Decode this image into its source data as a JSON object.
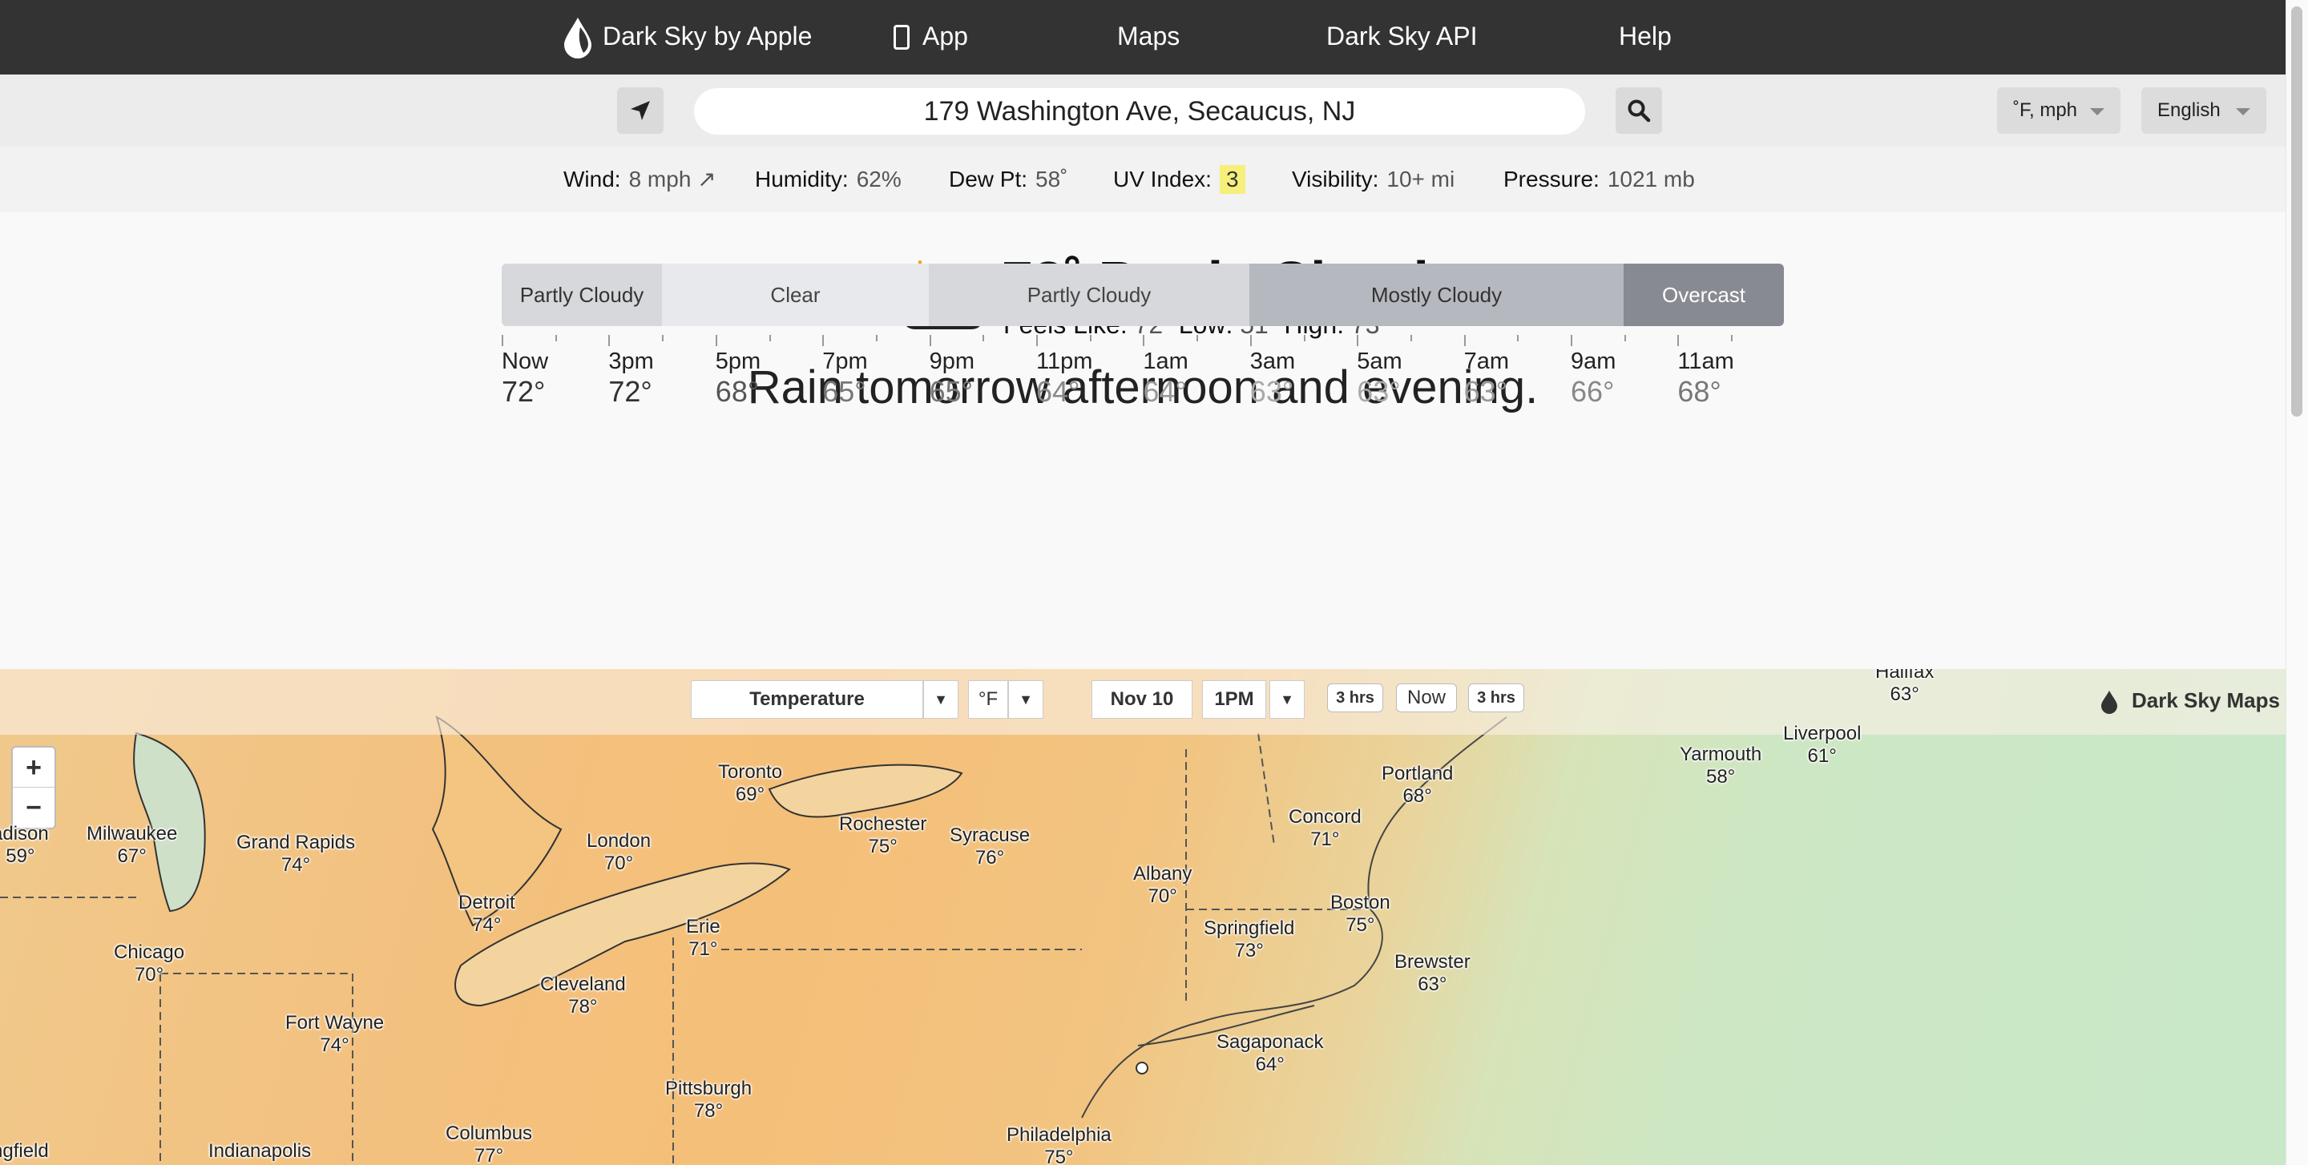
{
  "nav": {
    "brand": "Dark Sky by Apple",
    "app": "App",
    "maps": "Maps",
    "api": "Dark Sky API",
    "help": "Help",
    "brand_icon": "raindrop-logo-icon",
    "app_icon": "phone-icon"
  },
  "search": {
    "address": "179 Washington Ave, Secaucus, NJ",
    "location_icon": "location-arrow-icon",
    "search_icon": "search-icon",
    "units": "˚F, mph",
    "language": "English"
  },
  "stats": {
    "wind_label": "Wind:",
    "wind_value": "8 mph ↗",
    "humidity_label": "Humidity:",
    "humidity_value": "62%",
    "dew_label": "Dew Pt:",
    "dew_value": "58˚",
    "uv_label": "UV Index:",
    "uv_value": "3",
    "visibility_label": "Visibility:",
    "visibility_value": "10+ mi",
    "pressure_label": "Pressure:",
    "pressure_value": "1021 mb",
    "uv_color": "#f6ef7a"
  },
  "current": {
    "icon": "partly-cloudy-icon",
    "headline": "72˚ Partly Cloudy.",
    "feels_label": "Feels Like:",
    "feels_value": "72˚",
    "low_label": "Low:",
    "low_value": "51˚",
    "high_label": "High:",
    "high_value": "73˚",
    "summary": "Rain tomorrow afternoon and evening."
  },
  "timeline": {
    "segments": [
      {
        "label": "Partly Cloudy",
        "color": "#d6d8dc",
        "text_color": "#333333"
      },
      {
        "label": "Clear",
        "color": "#e8e9ec",
        "text_color": "#444444"
      },
      {
        "label": "Partly Cloudy",
        "color": "#d6d8dc",
        "text_color": "#444444"
      },
      {
        "label": "Mostly Cloudy",
        "color": "#b5b8bf",
        "text_color": "#333333"
      },
      {
        "label": "Overcast",
        "color": "#878a91",
        "text_color": "#ffffff"
      }
    ],
    "hours": [
      {
        "time": "Now",
        "temp": "72°",
        "color": "#333333"
      },
      {
        "time": "3pm",
        "temp": "72°",
        "color": "#333333"
      },
      {
        "time": "5pm",
        "temp": "68°",
        "color": "#555555"
      },
      {
        "time": "7pm",
        "temp": "65°",
        "color": "#777777"
      },
      {
        "time": "9pm",
        "temp": "65°",
        "color": "#777777"
      },
      {
        "time": "11pm",
        "temp": "64°",
        "color": "#888888"
      },
      {
        "time": "1am",
        "temp": "64°",
        "color": "#999999"
      },
      {
        "time": "3am",
        "temp": "63°",
        "color": "#aaaaaa"
      },
      {
        "time": "5am",
        "temp": "63°",
        "color": "#aaaaaa"
      },
      {
        "time": "7am",
        "temp": "63°",
        "color": "#999999"
      },
      {
        "time": "9am",
        "temp": "66°",
        "color": "#888888"
      },
      {
        "time": "11am",
        "temp": "68°",
        "color": "#777777"
      }
    ]
  },
  "map": {
    "layer": "Temperature",
    "unit": "°F",
    "date": "Nov 10",
    "time": "1PM",
    "back_step": "3 hrs",
    "now": "Now",
    "forward_step": "3 hrs",
    "brand": "Dark Sky Maps",
    "zoom_in": "+",
    "zoom_out": "−",
    "cities": [
      {
        "name": "Milwaukee",
        "temp": "67°"
      },
      {
        "name": "Grand Rapids",
        "temp": "74°"
      },
      {
        "name": "Toronto",
        "temp": "69°"
      },
      {
        "name": "London",
        "temp": "70°"
      },
      {
        "name": "Rochester",
        "temp": "75°"
      },
      {
        "name": "Syracuse",
        "temp": "76°"
      },
      {
        "name": "Albany",
        "temp": "70°"
      },
      {
        "name": "Concord",
        "temp": "71°"
      },
      {
        "name": "Portland",
        "temp": "68°"
      },
      {
        "name": "Yarmouth",
        "temp": "58°"
      },
      {
        "name": "Liverpool",
        "temp": "61°"
      },
      {
        "name": "Halifax",
        "temp": "63°"
      },
      {
        "name": "Detroit",
        "temp": "74°"
      },
      {
        "name": "Chicago",
        "temp": "70°"
      },
      {
        "name": "Erie",
        "temp": "71°"
      },
      {
        "name": "Cleveland",
        "temp": "78°"
      },
      {
        "name": "Fort Wayne",
        "temp": "74°"
      },
      {
        "name": "Springfield",
        "temp": "73°"
      },
      {
        "name": "Boston",
        "temp": "75°"
      },
      {
        "name": "Brewster",
        "temp": "63°"
      },
      {
        "name": "Sagaponack",
        "temp": "64°"
      },
      {
        "name": "Pittsburgh",
        "temp": "78°"
      },
      {
        "name": "Columbus",
        "temp": "77°"
      },
      {
        "name": "Indianapolis",
        "temp": ""
      },
      {
        "name": "Philadelphia",
        "temp": "75°"
      },
      {
        "name": "adison",
        "temp": "59°"
      },
      {
        "name": "ngfield",
        "temp": ""
      }
    ]
  }
}
